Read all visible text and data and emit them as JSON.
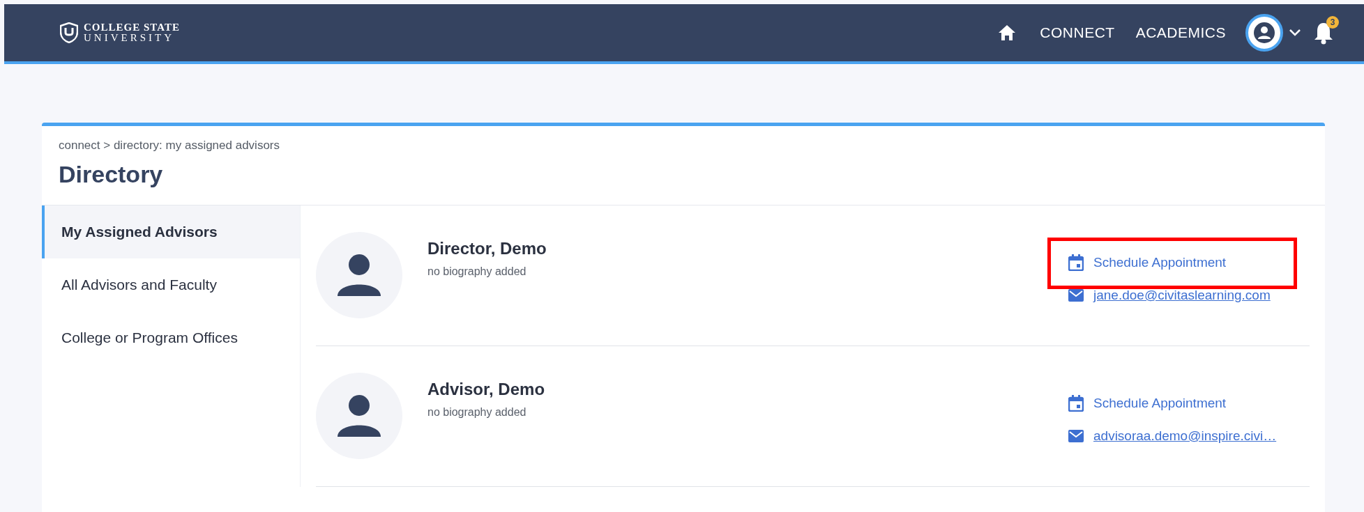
{
  "header": {
    "logo_line_1": "COLLEGE STATE",
    "logo_line_2": "UNIVERSITY",
    "nav": [
      "CONNECT",
      "ACADEMICS"
    ],
    "notifications": "3"
  },
  "breadcrumb": "connect > directory: my assigned advisors",
  "title": "Directory",
  "sidebar": {
    "items": [
      {
        "label": "My Assigned Advisors",
        "selected": true
      },
      {
        "label": "All Advisors and Faculty",
        "selected": false
      },
      {
        "label": "College or Program Offices",
        "selected": false
      }
    ]
  },
  "advisors": [
    {
      "name": "Director, Demo",
      "bio": "no biography added",
      "schedule": "Schedule Appointment",
      "email": "jane.doe@civitaslearning.com",
      "highlighted": true
    },
    {
      "name": "Advisor, Demo",
      "bio": "no biography added",
      "schedule": "Schedule Appointment",
      "email": "advisoraa.demo@inspire.civi…",
      "highlighted": false
    }
  ]
}
